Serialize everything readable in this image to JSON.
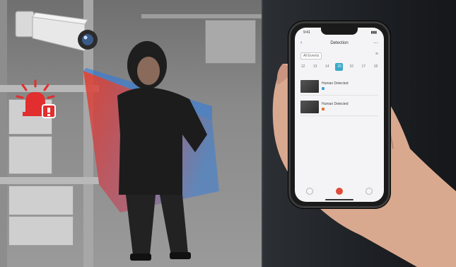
{
  "phone_app": {
    "status_time": "9:41",
    "status_icons": "▮▮▮",
    "header": {
      "back": "‹",
      "title": "Detection",
      "action": "⋯"
    },
    "filter": {
      "chip_label": "All Events",
      "menu_icon": "≡"
    },
    "dates": [
      "12",
      "13",
      "14",
      "15",
      "16",
      "17",
      "18"
    ],
    "events": [
      {
        "title": "Human Detected",
        "tag_color": "#3aa0d9"
      },
      {
        "title": "Human Detected",
        "tag_color": "#e0722d"
      }
    ]
  },
  "colors": {
    "alert_red": "#e22e2e",
    "beam_red": "#e0402f",
    "beam_blue": "#2d7be0",
    "accent": "#3aa9c9"
  },
  "icons": {
    "alert": "siren-alert-icon",
    "camera": "security-camera-icon"
  }
}
